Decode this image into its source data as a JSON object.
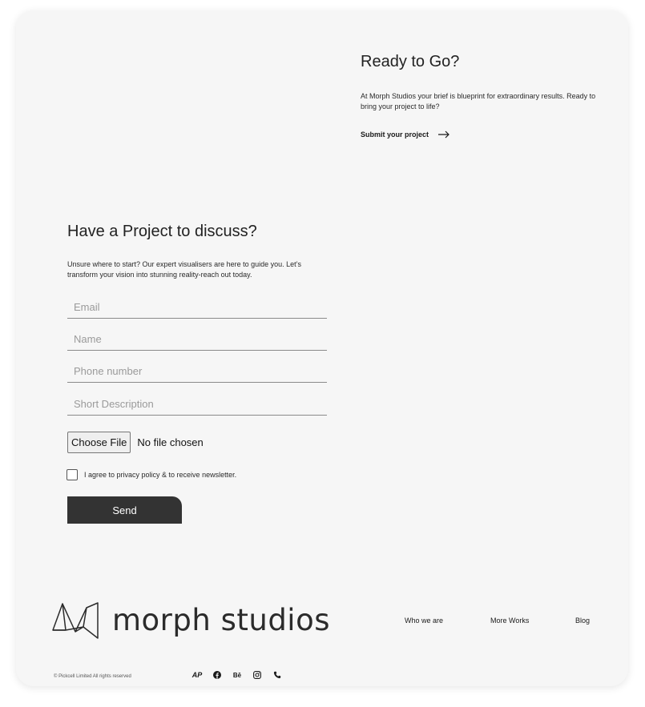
{
  "ready": {
    "title": "Ready to Go?",
    "text": "At Morph Studios your brief is blueprint for extraordinary results. Ready to bring your project to life?",
    "link_label": "Submit your project"
  },
  "project": {
    "title": "Have a Project to discuss?",
    "text": "Unsure where to start? Our expert visualisers are here to guide you. Let’s transform your vision into stunning reality-reach out today."
  },
  "form": {
    "email_placeholder": "Email",
    "name_placeholder": "Name",
    "phone_placeholder": "Phone number",
    "description_placeholder": "Short Description",
    "file_button": "Choose File",
    "file_status": "No file chosen",
    "agree_label": "I agree to privacy policy & to receive newsletter.",
    "send_label": "Send"
  },
  "footer": {
    "brand": "morph studios",
    "nav": [
      "Who we are",
      "More Works",
      "Blog"
    ],
    "copyright": "© Pickcell Limited All rights reserved",
    "social_icons": [
      "ap-logo-icon",
      "facebook-icon",
      "behance-icon",
      "instagram-icon",
      "phone-icon"
    ],
    "social_labels": [
      "AP",
      "Bē"
    ]
  }
}
